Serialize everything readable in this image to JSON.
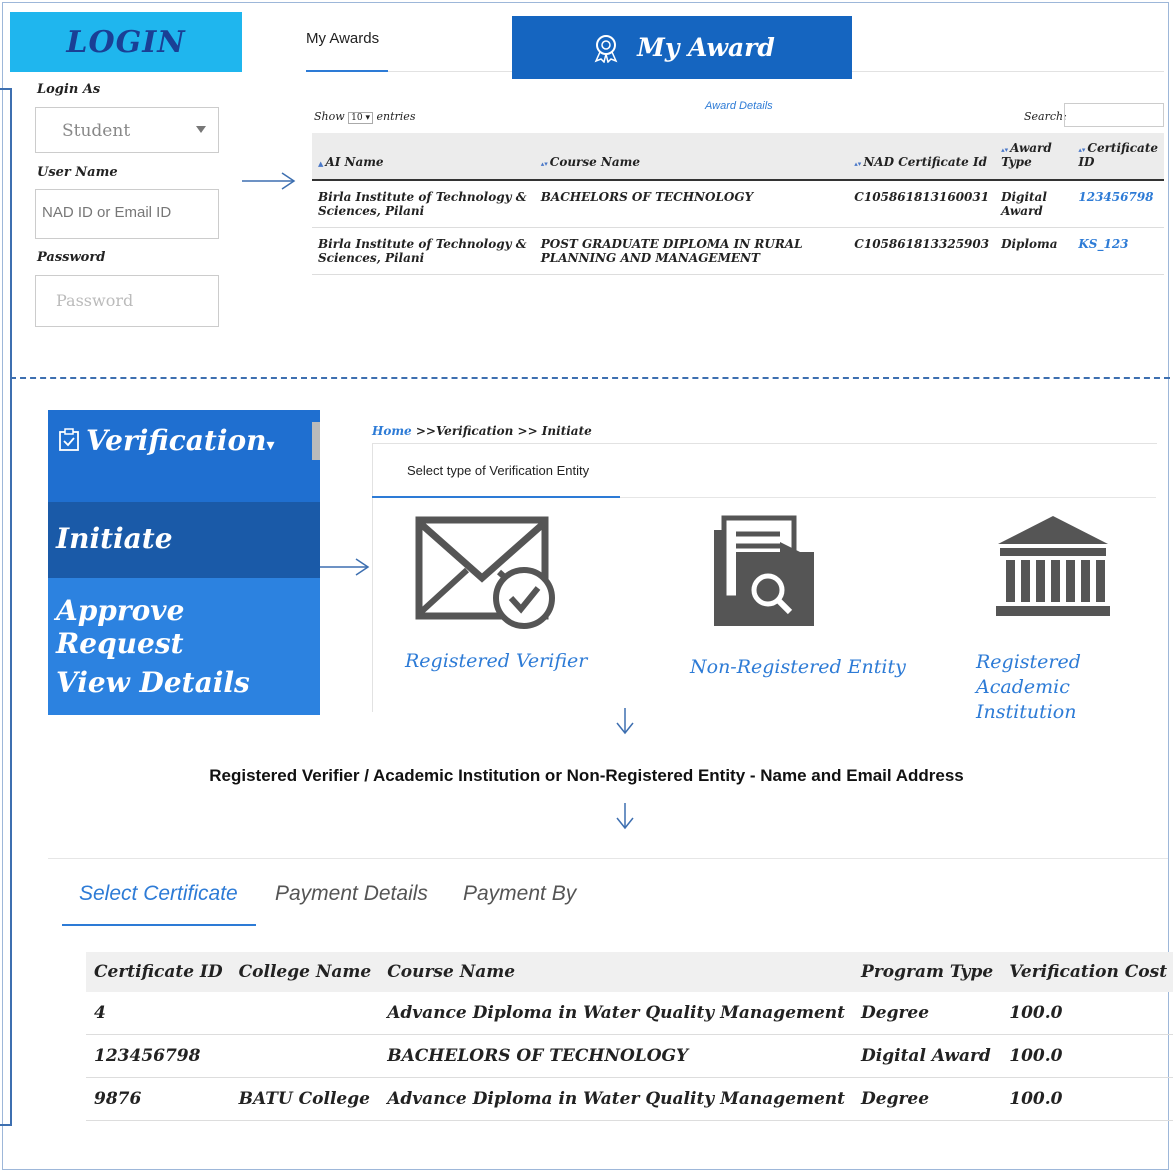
{
  "login": {
    "banner": "LOGIN",
    "login_as_label": "Login As",
    "login_as_value": "Student",
    "username_label": "User Name",
    "username_placeholder": "NAD ID or Email ID",
    "password_label": "Password",
    "password_placeholder": "Password"
  },
  "awards": {
    "tab_label": "My Awards",
    "banner": "My Award",
    "show_label": "Show",
    "entries_value": "10",
    "entries_label": "entries",
    "section_title": "Award Details",
    "search_label": "Search:",
    "columns": [
      "AI Name",
      "Course Name",
      "NAD Certificate Id",
      "Award Type",
      "Certificate ID"
    ],
    "rows": [
      {
        "ai_name": "Birla Institute of Technology & Sciences, Pilani",
        "course": "BACHELORS OF TECHNOLOGY",
        "nad_id": "C105861813160031",
        "award_type": "Digital Award",
        "cert_id": "123456798"
      },
      {
        "ai_name": "Birla Institute of Technology & Sciences, Pilani",
        "course": "POST GRADUATE DIPLOMA IN RURAL PLANNING AND MANAGEMENT",
        "nad_id": "C105861813325903",
        "award_type": "Diploma",
        "cert_id": "KS_123"
      }
    ]
  },
  "verification_menu": {
    "header": "Verification",
    "items": [
      "Initiate",
      "Approve Request",
      "View Details"
    ]
  },
  "verification": {
    "breadcrumb_home": "Home",
    "breadcrumb_rest": " >>Verification >> Initiate",
    "select_type_label": "Select type of Verification Entity",
    "options": [
      {
        "label": "Registered Verifier",
        "icon": "envelope-check-icon"
      },
      {
        "label": "Non-Registered Entity",
        "icon": "document-search-icon"
      },
      {
        "label": "Registered Academic Institution",
        "icon": "institution-icon"
      }
    ]
  },
  "flow_text": "Registered Verifier / Academic Institution or Non-Registered Entity - Name and Email Address",
  "certificate": {
    "tabs": [
      "Select Certificate",
      "Payment Details",
      "Payment By"
    ],
    "columns": [
      "Certificate ID",
      "College Name",
      "Course Name",
      "Program Type",
      "Verification Cost"
    ],
    "rows": [
      {
        "cert_id": "4",
        "college": "",
        "course": "Advance Diploma in Water Quality Management",
        "program": "Degree",
        "cost": "100.0",
        "checked": true
      },
      {
        "cert_id": "123456798",
        "college": "",
        "course": "BACHELORS OF TECHNOLOGY",
        "program": "Digital Award",
        "cost": "100.0",
        "checked": true
      },
      {
        "cert_id": "9876",
        "college": "BATU College",
        "course": "Advance Diploma in Water Quality Management",
        "program": "Degree",
        "cost": "100.0",
        "checked": false
      }
    ]
  },
  "colors": {
    "accent": "#2d7bd6",
    "login_banner_bg": "#1fb6ee",
    "award_banner_bg": "#1565c0",
    "menu_bg": "#2c82e0"
  }
}
